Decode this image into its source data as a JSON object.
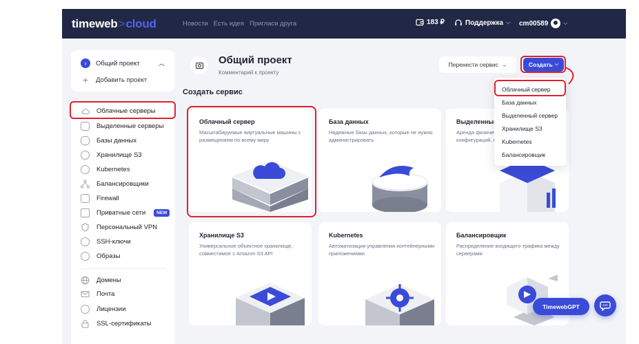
{
  "brand": {
    "name": "timeweb",
    "separator": ">",
    "suffix": "cloud"
  },
  "topnav": [
    "Новости",
    "Есть идея",
    "Пригласи друга"
  ],
  "balance": {
    "amount": "183 ₽",
    "icon": "wallet-icon"
  },
  "support": {
    "label": "Поддержка",
    "icon": "headset-icon"
  },
  "account": {
    "id": "cm00589",
    "icon": "user-avatar-icon"
  },
  "project_card": {
    "name": "Общий проект",
    "add_label": "Добавить проект"
  },
  "sidebar": {
    "items": [
      {
        "label": "Облачные серверы",
        "icon": "cloud-icon"
      },
      {
        "label": "Выделенные серверы",
        "icon": "server-icon"
      },
      {
        "label": "Базы данных",
        "icon": "database-icon"
      },
      {
        "label": "Хранилище S3",
        "icon": "storage-icon"
      },
      {
        "label": "Kubernetes",
        "icon": "kubernetes-icon"
      },
      {
        "label": "Балансировщики",
        "icon": "balancer-icon"
      },
      {
        "label": "Firewall",
        "icon": "firewall-icon"
      },
      {
        "label": "Приватные сети",
        "icon": "network-icon",
        "badge": "NEW"
      },
      {
        "label": "Персональный VPN",
        "icon": "shield-icon"
      },
      {
        "label": "SSH-ключи",
        "icon": "key-icon"
      },
      {
        "label": "Образы",
        "icon": "image-icon"
      },
      {
        "label": "Домены",
        "icon": "globe-icon"
      },
      {
        "label": "Почта",
        "icon": "mail-icon"
      },
      {
        "label": "Лицензии",
        "icon": "license-icon"
      },
      {
        "label": "SSL-сертификаты",
        "icon": "lock-icon"
      }
    ]
  },
  "header": {
    "title": "Общий проект",
    "comment": "Комментарий к проекту",
    "move_button": "Перенести сервис",
    "create_button": "Создать"
  },
  "section_title": "Создать сервис",
  "cards": [
    {
      "title": "Облачный сервер",
      "desc": "Масштабируемые виртуальные машины с размещением по всему миру"
    },
    {
      "title": "База данных",
      "desc": "Надежные базы данных, которые не нужно администрировать"
    },
    {
      "title": "Выделенный сервер",
      "desc": "Аренда физических серверов любой конфигураций, готовых к работе"
    },
    {
      "title": "Хранилище S3",
      "desc": "Универсальное объектное хранилище, совместимое с Amazon S3 API"
    },
    {
      "title": "Kubernetes",
      "desc": "Автоматизация управления контейнерными приложениями"
    },
    {
      "title": "Балансировщик",
      "desc": "Распределение входящего трафика между серверами"
    }
  ],
  "dropdown": {
    "items": [
      "Облачный сервер",
      "База данных",
      "Выделенный сервер",
      "Хранилище S3",
      "Kubernetes",
      "Балансировщик"
    ]
  },
  "floating": {
    "gpt_label": "TimewebGPT",
    "chat_icon": "chat-icon"
  },
  "colors": {
    "nav_bg": "#212845",
    "accent": "#3a4bd8",
    "highlight": "#e0202e",
    "page_bg": "#f3f4f8"
  }
}
